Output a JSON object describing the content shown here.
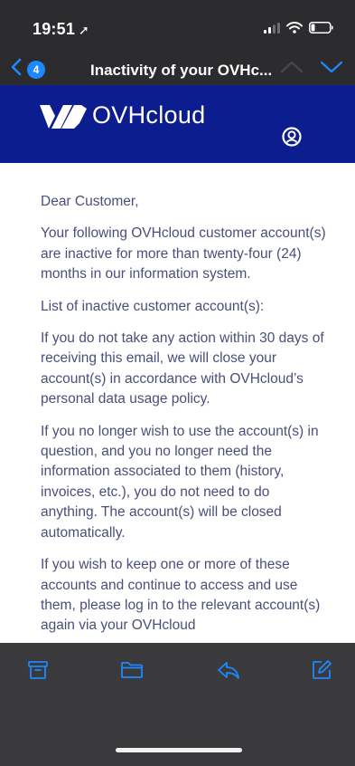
{
  "status_bar": {
    "time": "19:51",
    "location_arrow": "➚"
  },
  "nav": {
    "unread_count": "4",
    "title": "Inactivity of your OVHc..."
  },
  "header": {
    "brand": "OVHcloud"
  },
  "email": {
    "paragraphs": [
      "Dear Customer,",
      "Your following OVHcloud customer account(s) are inactive for more than twenty-four (24) months in our information system.",
      "List of inactive customer account(s):",
      "If you do not take any action within 30 days of receiving this email, we will close your account(s) in accordance with OVHcloud’s personal data usage policy.",
      "If you no longer wish to use the account(s) in question, and you no longer need the information associated to them (history, invoices, etc.), you do not need to do anything. The account(s) will be closed automatically.",
      "If you wish to keep one or more of these accounts and continue to access and use them, please log in to the relevant account(s) again via your OVHcloud"
    ]
  },
  "icons": {
    "archive": "archive-icon",
    "folder": "folder-icon",
    "reply": "reply-icon",
    "compose": "compose-icon"
  },
  "colors": {
    "accent": "#1e88ff",
    "banner": "#0c1d8f",
    "body_text": "#4a4f7a",
    "chrome": "#2c2c2e",
    "toolbar": "#3a3a3c"
  }
}
